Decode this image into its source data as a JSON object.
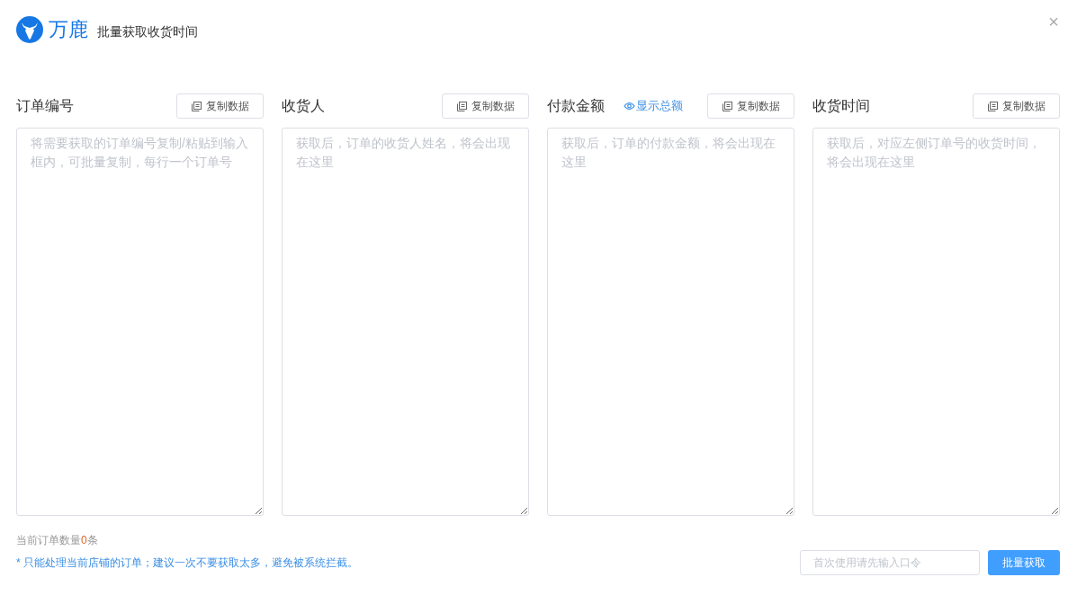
{
  "header": {
    "brand": "万鹿",
    "title": "批量获取收货时间",
    "close": "×"
  },
  "columns": [
    {
      "label": "订单编号",
      "copy_button": "复制数据",
      "placeholder": "将需要获取的订单编号复制/粘贴到输入框内，可批量复制，每行一个订单号"
    },
    {
      "label": "收货人",
      "copy_button": "复制数据",
      "placeholder": "获取后，订单的收货人姓名，将会出现在这里"
    },
    {
      "label": "付款金额",
      "link": "显示总额",
      "copy_button": "复制数据",
      "placeholder": "获取后，订单的付款金额，将会出现在这里"
    },
    {
      "label": "收货时间",
      "copy_button": "复制数据",
      "placeholder": "获取后，对应左侧订单号的收货时间，将会出现在这里"
    }
  ],
  "order_count": {
    "prefix": "当前订单数量",
    "count": "0",
    "suffix": "条"
  },
  "notice": "* 只能处理当前店铺的订单；建议一次不要获取太多，避免被系统拦截。",
  "password": {
    "placeholder": "首次使用请先输入口令"
  },
  "submit_button": "批量获取"
}
